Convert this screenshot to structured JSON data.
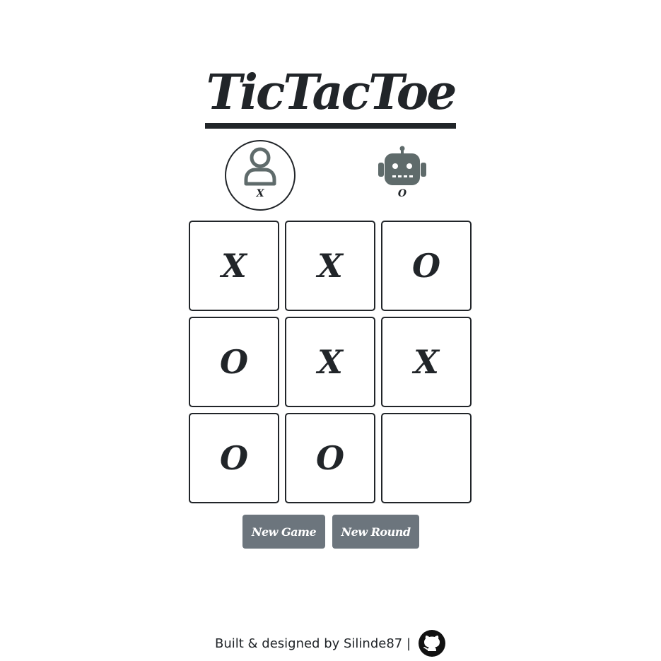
{
  "title": "TicTacToe",
  "players": {
    "human": {
      "symbol": "X",
      "icon": "user-icon",
      "active": true
    },
    "bot": {
      "symbol": "O",
      "icon": "robot-icon",
      "active": false
    }
  },
  "board": {
    "cells": [
      "X",
      "X",
      "O",
      "O",
      "X",
      "X",
      "O",
      "O",
      ""
    ]
  },
  "buttons": {
    "new_game": "New Game",
    "new_round": "New Round"
  },
  "footer": {
    "credit": "Built & designed by Silinde87 |",
    "icon": "github-icon"
  },
  "colors": {
    "text": "#212529",
    "button_bg": "#6c757d",
    "bot_icon": "#5f6b6b",
    "human_icon": "#5f6b6b"
  }
}
